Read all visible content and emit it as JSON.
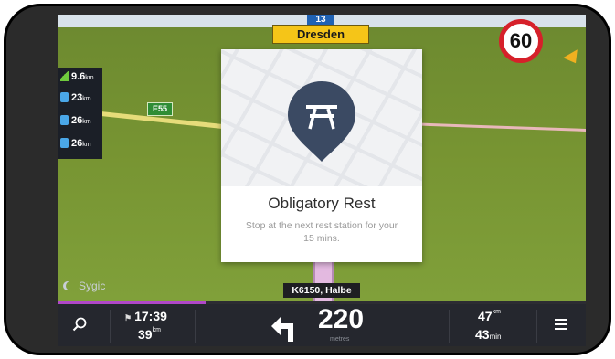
{
  "map": {
    "signpost": {
      "number": "13",
      "city": "Dresden"
    },
    "speed_limit": "60",
    "road_label": "E55",
    "street_name": "K6150, Halbe",
    "brand": "Sygic"
  },
  "stats": [
    {
      "icon": "elevation-icon",
      "value": "9.6",
      "unit": "km"
    },
    {
      "icon": "fuel-station-icon",
      "value": "23",
      "unit": "km"
    },
    {
      "icon": "fuel-station-icon",
      "value": "26",
      "unit": "km"
    },
    {
      "icon": "fuel-station-icon",
      "value": "26",
      "unit": "km"
    }
  ],
  "notification": {
    "icon": "picnic-table-icon",
    "title": "Obligatory Rest",
    "text": "Stop at the next rest station for your 15 mins."
  },
  "route_progress": 0.28,
  "bottom_bar": {
    "eta_time": "17:39",
    "eta_distance": "39",
    "eta_distance_unit": "km",
    "turn_distance": "220",
    "turn_unit": "metres",
    "remaining_distance": "47",
    "remaining_distance_unit": "km",
    "remaining_time": "43",
    "remaining_time_unit": "min"
  },
  "colors": {
    "accent": "#b047c8",
    "card_pin": "#3b4a63",
    "speed_ring": "#d6202a"
  }
}
